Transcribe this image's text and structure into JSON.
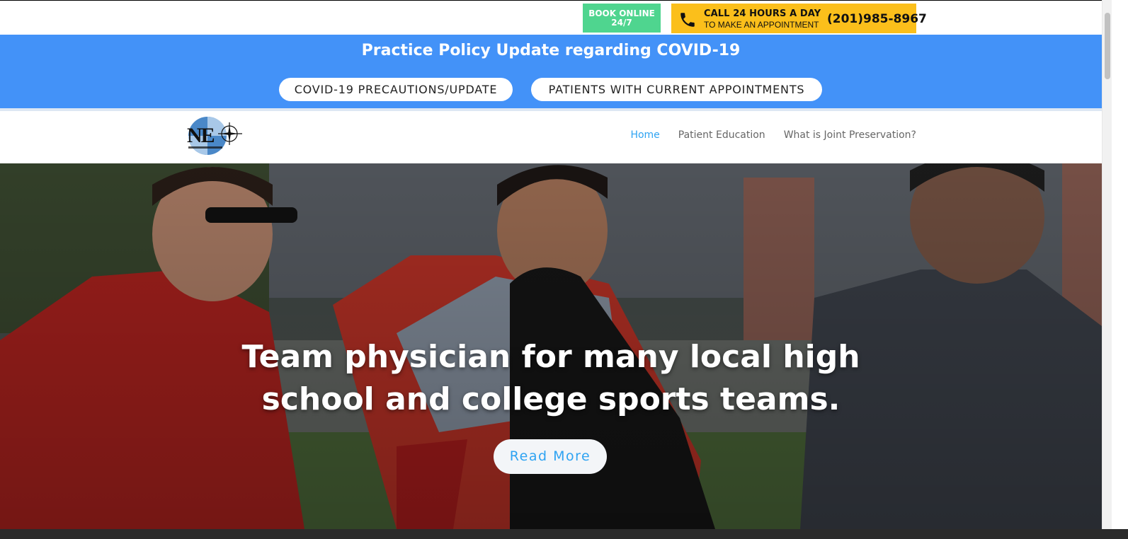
{
  "topbar": {
    "book_online_line1": "BOOK ONLINE",
    "book_online_line2": "24/7",
    "call_title": "CALL 24 HOURS A DAY",
    "call_subtitle": "TO MAKE AN APPOINTMENT",
    "phone_number": "(201)985-8967",
    "icons": {
      "phone": "phone-icon"
    },
    "colors": {
      "book_bg": "#4fd58f",
      "call_bg": "#fbbf1b"
    }
  },
  "covid_banner": {
    "title": "Practice Policy Update regarding COVID-19",
    "buttons": [
      {
        "label": "COVID-19 PRECAUTIONS/UPDATE"
      },
      {
        "label": "PATIENTS WITH CURRENT APPOINTMENTS"
      }
    ],
    "colors": {
      "bg": "#4392f8"
    }
  },
  "header": {
    "logo_text": "NEO",
    "nav": [
      {
        "label": "Home",
        "active": true
      },
      {
        "label": "Patient Education",
        "active": false
      },
      {
        "label": "What is Joint Preservation?",
        "active": false
      }
    ],
    "colors": {
      "active": "#2ea3f2"
    }
  },
  "hero": {
    "title_line1": "Team physician for many local high",
    "title_line2": "school and college sports teams.",
    "button_label": "Read More"
  }
}
